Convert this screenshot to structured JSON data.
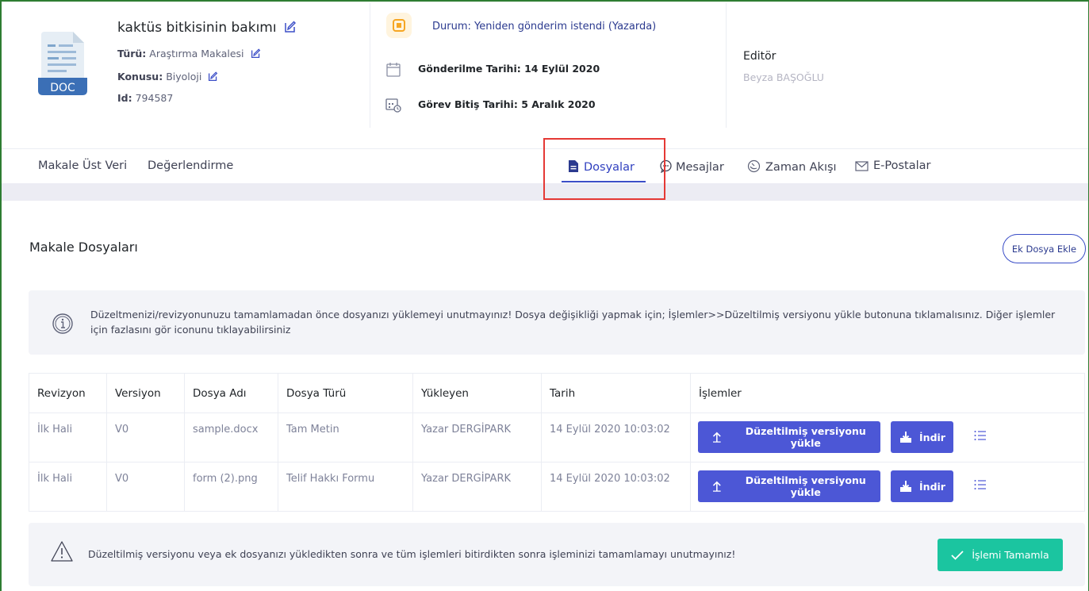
{
  "header": {
    "title": "kaktüs bitkisinin bakımı",
    "doc_icon_label": "DOC",
    "type_label": "Türü:",
    "type_value": "Araştırma Makalesi",
    "subject_label": "Konusu:",
    "subject_value": "Biyoloji",
    "id_label": "Id:",
    "id_value": "794587",
    "status": "Durum: Yeniden gönderim istendi (Yazarda)",
    "submitted": "Gönderilme Tarihi: 14 Eylül 2020",
    "deadline": "Görev Bitiş Tarihi: 5 Aralık 2020",
    "editor_label": "Editör",
    "editor_name": "Beyza BAŞOĞLU"
  },
  "nav": {
    "metadata": "Makale Üst Veri",
    "review": "Değerlendirme",
    "files": "Dosyalar",
    "messages": "Mesajlar",
    "timeline": "Zaman Akışı",
    "emails": "E-Postalar"
  },
  "section": {
    "title": "Makale Dosyaları",
    "add_file": "Ek Dosya Ekle",
    "info": "Düzeltmenizi/revizyonunuzu tamamlamadan önce dosyanızı yüklemeyi unutmayınız! Dosya değişikliği yapmak için; İşlemler>>Düzeltilmiş versiyonu yükle butonuna tıklamalısınız. Diğer işlemler için fazlasını gör iconunu tıklayabilirsiniz"
  },
  "table": {
    "headers": [
      "Revizyon",
      "Versiyon",
      "Dosya Adı",
      "Dosya Türü",
      "Yükleyen",
      "Tarih",
      "İşlemler"
    ],
    "rows": [
      {
        "revision": "İlk Hali",
        "version": "V0",
        "file": "sample.docx",
        "type": "Tam Metin",
        "uploader": "Yazar DERGİPARK",
        "date": "14 Eylül 2020 10:03:02"
      },
      {
        "revision": "İlk Hali",
        "version": "V0",
        "file": "form (2).png",
        "type": "Telif Hakkı Formu",
        "uploader": "Yazar DERGİPARK",
        "date": "14 Eylül 2020 10:03:02"
      }
    ],
    "upload_label": "Düzeltilmiş versiyonu yükle",
    "download_label": "İndir"
  },
  "notice": {
    "text": "Düzeltilmiş versiyonu veya ek dosyanızı yükledikten sonra ve tüm işlemleri bitirdikten sonra işleminizi tamamlamayı unutmayınız!",
    "complete_label": "İşlemi Tamamla"
  },
  "colors": {
    "primary": "#4c57d6",
    "success": "#1bc5a0",
    "highlight": "#e53935",
    "frame": "#2e7d32"
  }
}
